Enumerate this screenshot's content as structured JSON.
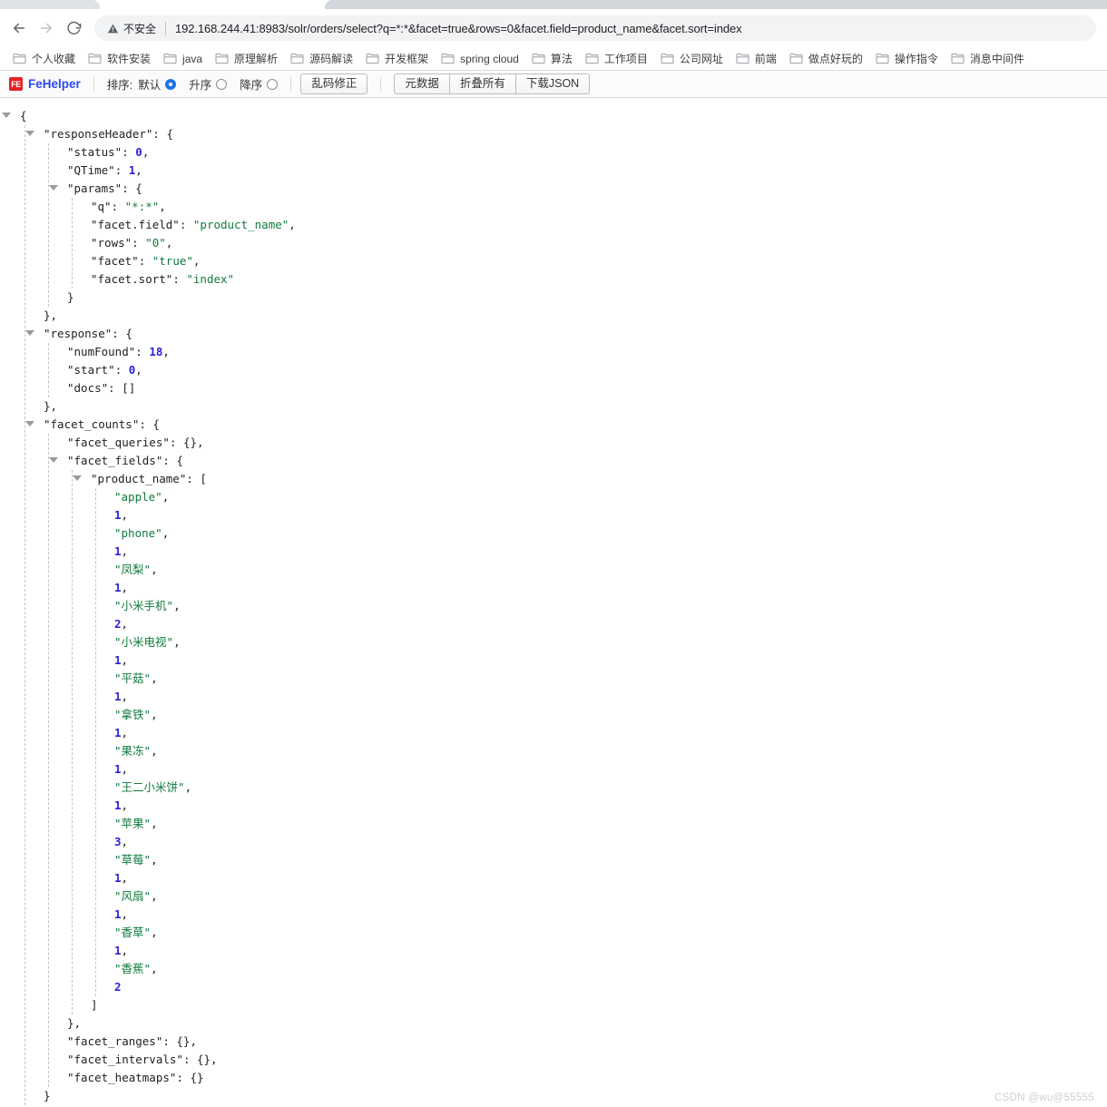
{
  "browser": {
    "nav": {
      "back_label": "Back",
      "forward_label": "Forward",
      "reload_label": "Reload"
    },
    "omnibox": {
      "security_label": "不安全",
      "security_icon": "warning-triangle-icon",
      "url": "192.168.244.41:8983/solr/orders/select?q=*:*&facet=true&rows=0&facet.field=product_name&facet.sort=index"
    },
    "bookmarks": [
      {
        "label": "个人收藏"
      },
      {
        "label": "软件安装"
      },
      {
        "label": "java"
      },
      {
        "label": "原理解析"
      },
      {
        "label": "源码解读"
      },
      {
        "label": "开发框架"
      },
      {
        "label": "spring cloud"
      },
      {
        "label": "算法"
      },
      {
        "label": "工作项目"
      },
      {
        "label": "公司网址"
      },
      {
        "label": "前端"
      },
      {
        "label": "做点好玩的"
      },
      {
        "label": "操作指令"
      },
      {
        "label": "消息中间件"
      }
    ]
  },
  "fehelper": {
    "badge_text": "FE",
    "name": "FeHelper",
    "sort_label": "排序:",
    "sort_options": [
      {
        "label": "默认",
        "selected": true
      },
      {
        "label": "升序",
        "selected": false
      },
      {
        "label": "降序",
        "selected": false
      }
    ],
    "fix_encoding_button": "乱码修正",
    "actions": [
      {
        "label": "元数据"
      },
      {
        "label": "折叠所有"
      },
      {
        "label": "下载JSON"
      }
    ]
  },
  "json_document": {
    "responseHeader": {
      "status": 0,
      "QTime": 1,
      "params": {
        "q": "*:*",
        "facet.field": "product_name",
        "rows": "0",
        "facet": "true",
        "facet.sort": "index"
      }
    },
    "response": {
      "numFound": 18,
      "start": 0,
      "docs": []
    },
    "facet_counts": {
      "facet_queries": {},
      "facet_fields": {
        "product_name": [
          "apple",
          1,
          "phone",
          1,
          "凤梨",
          1,
          "小米手机",
          2,
          "小米电视",
          1,
          "平菇",
          1,
          "拿铁",
          1,
          "果冻",
          1,
          "王二小米饼",
          1,
          "苹果",
          3,
          "草莓",
          1,
          "风扇",
          1,
          "香草",
          1,
          "香蕉",
          2
        ]
      },
      "facet_ranges": {},
      "facet_intervals": {},
      "facet_heatmaps": {}
    }
  },
  "json_lines": [
    {
      "indent": 0,
      "tri": true,
      "tokens": [
        {
          "t": "pun",
          "v": "{"
        }
      ]
    },
    {
      "indent": 1,
      "tri": true,
      "tokens": [
        {
          "t": "k",
          "v": "\"responseHeader\""
        },
        {
          "t": "pun",
          "v": ": {"
        }
      ]
    },
    {
      "indent": 2,
      "tri": false,
      "tokens": [
        {
          "t": "k",
          "v": "\"status\""
        },
        {
          "t": "pun",
          "v": ": "
        },
        {
          "t": "num",
          "v": "0"
        },
        {
          "t": "pun",
          "v": ","
        }
      ]
    },
    {
      "indent": 2,
      "tri": false,
      "tokens": [
        {
          "t": "k",
          "v": "\"QTime\""
        },
        {
          "t": "pun",
          "v": ": "
        },
        {
          "t": "num",
          "v": "1"
        },
        {
          "t": "pun",
          "v": ","
        }
      ]
    },
    {
      "indent": 2,
      "tri": true,
      "tokens": [
        {
          "t": "k",
          "v": "\"params\""
        },
        {
          "t": "pun",
          "v": ": {"
        }
      ]
    },
    {
      "indent": 3,
      "tri": false,
      "tokens": [
        {
          "t": "k",
          "v": "\"q\""
        },
        {
          "t": "pun",
          "v": ": "
        },
        {
          "t": "str",
          "v": "\"*:*\""
        },
        {
          "t": "pun",
          "v": ","
        }
      ]
    },
    {
      "indent": 3,
      "tri": false,
      "tokens": [
        {
          "t": "k",
          "v": "\"facet.field\""
        },
        {
          "t": "pun",
          "v": ": "
        },
        {
          "t": "str",
          "v": "\"product_name\""
        },
        {
          "t": "pun",
          "v": ","
        }
      ]
    },
    {
      "indent": 3,
      "tri": false,
      "tokens": [
        {
          "t": "k",
          "v": "\"rows\""
        },
        {
          "t": "pun",
          "v": ": "
        },
        {
          "t": "str",
          "v": "\"0\""
        },
        {
          "t": "pun",
          "v": ","
        }
      ]
    },
    {
      "indent": 3,
      "tri": false,
      "tokens": [
        {
          "t": "k",
          "v": "\"facet\""
        },
        {
          "t": "pun",
          "v": ": "
        },
        {
          "t": "str",
          "v": "\"true\""
        },
        {
          "t": "pun",
          "v": ","
        }
      ]
    },
    {
      "indent": 3,
      "tri": false,
      "tokens": [
        {
          "t": "k",
          "v": "\"facet.sort\""
        },
        {
          "t": "pun",
          "v": ": "
        },
        {
          "t": "str",
          "v": "\"index\""
        }
      ]
    },
    {
      "indent": 2,
      "tri": false,
      "tokens": [
        {
          "t": "pun",
          "v": "}"
        }
      ]
    },
    {
      "indent": 1,
      "tri": false,
      "tokens": [
        {
          "t": "pun",
          "v": "},"
        }
      ]
    },
    {
      "indent": 1,
      "tri": true,
      "tokens": [
        {
          "t": "k",
          "v": "\"response\""
        },
        {
          "t": "pun",
          "v": ": {"
        }
      ]
    },
    {
      "indent": 2,
      "tri": false,
      "tokens": [
        {
          "t": "k",
          "v": "\"numFound\""
        },
        {
          "t": "pun",
          "v": ": "
        },
        {
          "t": "num",
          "v": "18"
        },
        {
          "t": "pun",
          "v": ","
        }
      ]
    },
    {
      "indent": 2,
      "tri": false,
      "tokens": [
        {
          "t": "k",
          "v": "\"start\""
        },
        {
          "t": "pun",
          "v": ": "
        },
        {
          "t": "num",
          "v": "0"
        },
        {
          "t": "pun",
          "v": ","
        }
      ]
    },
    {
      "indent": 2,
      "tri": false,
      "tokens": [
        {
          "t": "k",
          "v": "\"docs\""
        },
        {
          "t": "pun",
          "v": ": []"
        }
      ]
    },
    {
      "indent": 1,
      "tri": false,
      "tokens": [
        {
          "t": "pun",
          "v": "},"
        }
      ]
    },
    {
      "indent": 1,
      "tri": true,
      "tokens": [
        {
          "t": "k",
          "v": "\"facet_counts\""
        },
        {
          "t": "pun",
          "v": ": {"
        }
      ]
    },
    {
      "indent": 2,
      "tri": false,
      "tokens": [
        {
          "t": "k",
          "v": "\"facet_queries\""
        },
        {
          "t": "pun",
          "v": ": {},"
        }
      ]
    },
    {
      "indent": 2,
      "tri": true,
      "tokens": [
        {
          "t": "k",
          "v": "\"facet_fields\""
        },
        {
          "t": "pun",
          "v": ": {"
        }
      ]
    },
    {
      "indent": 3,
      "tri": true,
      "tokens": [
        {
          "t": "k",
          "v": "\"product_name\""
        },
        {
          "t": "pun",
          "v": ": ["
        }
      ]
    },
    {
      "indent": 4,
      "tri": false,
      "tokens": [
        {
          "t": "str",
          "v": "\"apple\""
        },
        {
          "t": "pun",
          "v": ","
        }
      ]
    },
    {
      "indent": 4,
      "tri": false,
      "tokens": [
        {
          "t": "num",
          "v": "1"
        },
        {
          "t": "pun",
          "v": ","
        }
      ]
    },
    {
      "indent": 4,
      "tri": false,
      "tokens": [
        {
          "t": "str",
          "v": "\"phone\""
        },
        {
          "t": "pun",
          "v": ","
        }
      ]
    },
    {
      "indent": 4,
      "tri": false,
      "tokens": [
        {
          "t": "num",
          "v": "1"
        },
        {
          "t": "pun",
          "v": ","
        }
      ]
    },
    {
      "indent": 4,
      "tri": false,
      "tokens": [
        {
          "t": "str",
          "v": "\"凤梨\""
        },
        {
          "t": "pun",
          "v": ","
        }
      ]
    },
    {
      "indent": 4,
      "tri": false,
      "tokens": [
        {
          "t": "num",
          "v": "1"
        },
        {
          "t": "pun",
          "v": ","
        }
      ]
    },
    {
      "indent": 4,
      "tri": false,
      "tokens": [
        {
          "t": "str",
          "v": "\"小米手机\""
        },
        {
          "t": "pun",
          "v": ","
        }
      ]
    },
    {
      "indent": 4,
      "tri": false,
      "tokens": [
        {
          "t": "num",
          "v": "2"
        },
        {
          "t": "pun",
          "v": ","
        }
      ]
    },
    {
      "indent": 4,
      "tri": false,
      "tokens": [
        {
          "t": "str",
          "v": "\"小米电视\""
        },
        {
          "t": "pun",
          "v": ","
        }
      ]
    },
    {
      "indent": 4,
      "tri": false,
      "tokens": [
        {
          "t": "num",
          "v": "1"
        },
        {
          "t": "pun",
          "v": ","
        }
      ]
    },
    {
      "indent": 4,
      "tri": false,
      "tokens": [
        {
          "t": "str",
          "v": "\"平菇\""
        },
        {
          "t": "pun",
          "v": ","
        }
      ]
    },
    {
      "indent": 4,
      "tri": false,
      "tokens": [
        {
          "t": "num",
          "v": "1"
        },
        {
          "t": "pun",
          "v": ","
        }
      ]
    },
    {
      "indent": 4,
      "tri": false,
      "tokens": [
        {
          "t": "str",
          "v": "\"拿铁\""
        },
        {
          "t": "pun",
          "v": ","
        }
      ]
    },
    {
      "indent": 4,
      "tri": false,
      "tokens": [
        {
          "t": "num",
          "v": "1"
        },
        {
          "t": "pun",
          "v": ","
        }
      ]
    },
    {
      "indent": 4,
      "tri": false,
      "tokens": [
        {
          "t": "str",
          "v": "\"果冻\""
        },
        {
          "t": "pun",
          "v": ","
        }
      ]
    },
    {
      "indent": 4,
      "tri": false,
      "tokens": [
        {
          "t": "num",
          "v": "1"
        },
        {
          "t": "pun",
          "v": ","
        }
      ]
    },
    {
      "indent": 4,
      "tri": false,
      "tokens": [
        {
          "t": "str",
          "v": "\"王二小米饼\""
        },
        {
          "t": "pun",
          "v": ","
        }
      ]
    },
    {
      "indent": 4,
      "tri": false,
      "tokens": [
        {
          "t": "num",
          "v": "1"
        },
        {
          "t": "pun",
          "v": ","
        }
      ]
    },
    {
      "indent": 4,
      "tri": false,
      "tokens": [
        {
          "t": "str",
          "v": "\"苹果\""
        },
        {
          "t": "pun",
          "v": ","
        }
      ]
    },
    {
      "indent": 4,
      "tri": false,
      "tokens": [
        {
          "t": "num",
          "v": "3"
        },
        {
          "t": "pun",
          "v": ","
        }
      ]
    },
    {
      "indent": 4,
      "tri": false,
      "tokens": [
        {
          "t": "str",
          "v": "\"草莓\""
        },
        {
          "t": "pun",
          "v": ","
        }
      ]
    },
    {
      "indent": 4,
      "tri": false,
      "tokens": [
        {
          "t": "num",
          "v": "1"
        },
        {
          "t": "pun",
          "v": ","
        }
      ]
    },
    {
      "indent": 4,
      "tri": false,
      "tokens": [
        {
          "t": "str",
          "v": "\"风扇\""
        },
        {
          "t": "pun",
          "v": ","
        }
      ]
    },
    {
      "indent": 4,
      "tri": false,
      "tokens": [
        {
          "t": "num",
          "v": "1"
        },
        {
          "t": "pun",
          "v": ","
        }
      ]
    },
    {
      "indent": 4,
      "tri": false,
      "tokens": [
        {
          "t": "str",
          "v": "\"香草\""
        },
        {
          "t": "pun",
          "v": ","
        }
      ]
    },
    {
      "indent": 4,
      "tri": false,
      "tokens": [
        {
          "t": "num",
          "v": "1"
        },
        {
          "t": "pun",
          "v": ","
        }
      ]
    },
    {
      "indent": 4,
      "tri": false,
      "tokens": [
        {
          "t": "str",
          "v": "\"香蕉\""
        },
        {
          "t": "pun",
          "v": ","
        }
      ]
    },
    {
      "indent": 4,
      "tri": false,
      "tokens": [
        {
          "t": "num",
          "v": "2"
        }
      ]
    },
    {
      "indent": 3,
      "tri": false,
      "tokens": [
        {
          "t": "pun",
          "v": "]"
        }
      ]
    },
    {
      "indent": 2,
      "tri": false,
      "tokens": [
        {
          "t": "pun",
          "v": "},"
        }
      ]
    },
    {
      "indent": 2,
      "tri": false,
      "tokens": [
        {
          "t": "k",
          "v": "\"facet_ranges\""
        },
        {
          "t": "pun",
          "v": ": {},"
        }
      ]
    },
    {
      "indent": 2,
      "tri": false,
      "tokens": [
        {
          "t": "k",
          "v": "\"facet_intervals\""
        },
        {
          "t": "pun",
          "v": ": {},"
        }
      ]
    },
    {
      "indent": 2,
      "tri": false,
      "tokens": [
        {
          "t": "k",
          "v": "\"facet_heatmaps\""
        },
        {
          "t": "pun",
          "v": ": {}"
        }
      ]
    },
    {
      "indent": 1,
      "tri": false,
      "tokens": [
        {
          "t": "pun",
          "v": "}"
        }
      ]
    }
  ],
  "watermark": "CSDN @wu@55555",
  "colors": {
    "string": "#107a3d",
    "number": "#2b21d8",
    "key": "#222222",
    "brand": "#2b4af0",
    "badge": "#e8202a"
  }
}
